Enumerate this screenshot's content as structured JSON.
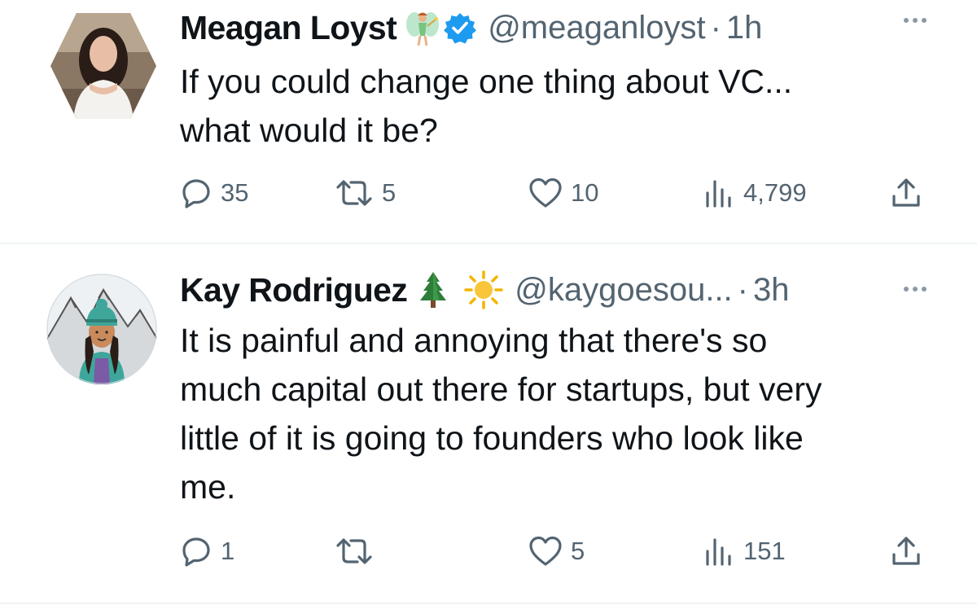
{
  "tweets": [
    {
      "author_name": "Meagan Loyst",
      "name_emoji": "fairy-emoji",
      "verified": true,
      "handle": "@meaganloyst",
      "separator": "·",
      "time": "1h",
      "text_lines": [
        "If you could change one thing about VC...",
        "what would it be?"
      ],
      "replies": "35",
      "retweets": "5",
      "likes": "10",
      "views": "4,799"
    },
    {
      "author_name": "Kay Rodriguez",
      "name_emojis": [
        "evergreen-tree-emoji",
        "sun-emoji"
      ],
      "handle": "@kaygoesou...",
      "separator": "·",
      "time": "3h",
      "text_lines": [
        "It is painful and annoying that there's so",
        "much capital out there for startups, but very",
        "little of it is going to founders who look like",
        "me."
      ],
      "replies": "1",
      "retweets": "",
      "likes": "5",
      "views": "151"
    }
  ],
  "icons": [
    "comment-icon",
    "retweet-icon",
    "heart-icon",
    "views-icon",
    "share-icon",
    "more-icon"
  ],
  "colors": {
    "text": "#0f1419",
    "secondary": "#536471",
    "verified": "#1d9bf0",
    "divider": "#eff3f4"
  }
}
